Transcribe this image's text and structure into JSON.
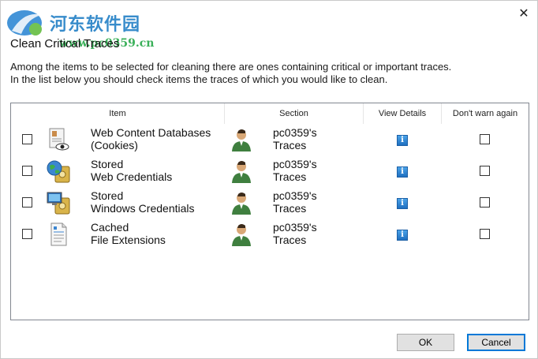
{
  "watermark": {
    "brand": "河东软件园",
    "url": "www.pc0359.cn"
  },
  "dialog": {
    "title": "Clean Critical Traces",
    "close_glyph": "✕",
    "description_line1": "Among the items to be selected for cleaning there are ones containing critical or important traces.",
    "description_line2": "In the list below you should check items the traces of which you would like to clean."
  },
  "list": {
    "columns": {
      "item": "Item",
      "section": "Section",
      "view_details": "View Details",
      "dont_warn": "Don't warn again"
    },
    "rows": [
      {
        "item_line1": "Web Content Databases",
        "item_line2": "(Cookies)",
        "section_line1": "pc0359's",
        "section_line2": "Traces",
        "icon": "document-eye-icon"
      },
      {
        "item_line1": "Stored",
        "item_line2": "Web Credentials",
        "section_line1": "pc0359's",
        "section_line2": "Traces",
        "icon": "globe-safe-icon"
      },
      {
        "item_line1": "Stored",
        "item_line2": "Windows Credentials",
        "section_line1": "pc0359's",
        "section_line2": "Traces",
        "icon": "computer-safe-icon"
      },
      {
        "item_line1": "Cached",
        "item_line2": "File Extensions",
        "section_line1": "pc0359's",
        "section_line2": "Traces",
        "icon": "file-list-icon"
      }
    ],
    "info_glyph": "i"
  },
  "buttons": {
    "ok": "OK",
    "cancel": "Cancel"
  }
}
